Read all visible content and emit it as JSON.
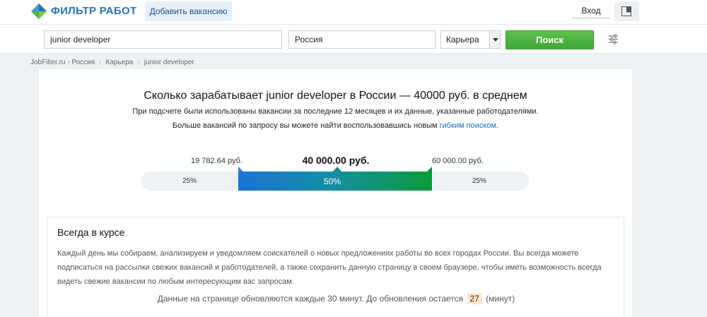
{
  "header": {
    "logo_text": "ФИЛЬТР РАБОТ",
    "logo_icon": "logo-diamond-icon",
    "add_vacancy": "Добавить вакансию",
    "login": "Вход",
    "favorites_icon": "bookmark-panel-icon"
  },
  "search": {
    "query": "junior developer",
    "location": "Россия",
    "category": "Карьера",
    "button": "Поиск",
    "filter_icon": "sliders-icon"
  },
  "breadcrumb": [
    "JobFilter.ru - Россия",
    "Карьера",
    "junior developer"
  ],
  "summary": {
    "headline": "Сколько зарабатывает junior developer в России — 40000 руб. в среднем",
    "line1": "При подсчете были использованы вакансии за последние 12 месяцев и их данные, указанные работодателями.",
    "line2_prefix": "Больше вакансий по запросу вы можете найти воспользовавшись новым ",
    "line2_link": "гибким поиском",
    "line2_suffix": "."
  },
  "salary": {
    "low": "19 782.64 руб.",
    "mid": "40 000.00 руб.",
    "high": "60 000.00 руб.",
    "left_pct": "25%",
    "mid_pct": "50%",
    "right_pct": "25%",
    "segments": [
      0.25,
      0.5,
      0.25
    ],
    "colors": {
      "blue": "#1b73d6",
      "green": "#0d9a3a",
      "brand": "#2a70b8",
      "search_button": "#4db540"
    }
  },
  "info": {
    "title": "Всегда в курсе",
    "text": "Каждый день мы собираем, анализируем и уведомляем соискателей о новых предложениях работы во всех городах России. Вы всегда можете подписаться на рассылки свежих вакансий и работодателей, а также сохранить данную страницу в своем браузере, чтобы иметь возможность всегда видеть свежие вакансии по любым интересующим вас запросам.",
    "update_prefix": "Данные на странице обновляются каждые 30 минут. До обновления остается",
    "update_value": "27",
    "update_suffix": "(минут)"
  }
}
